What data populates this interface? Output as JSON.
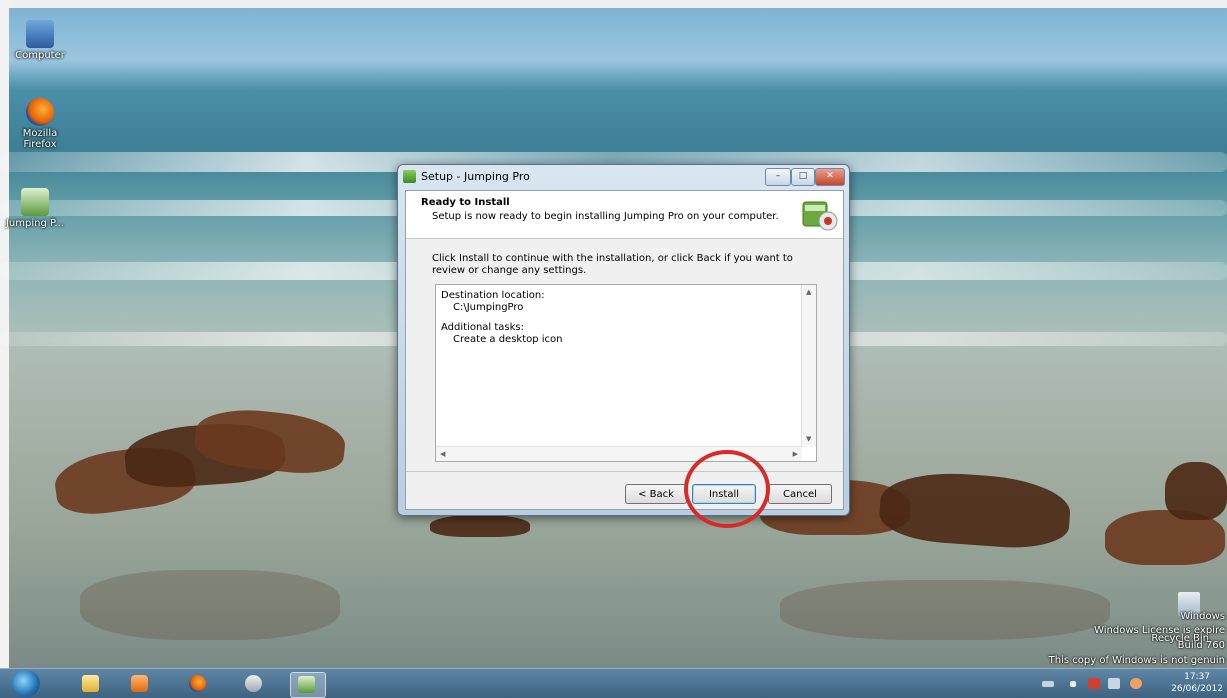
{
  "desktop": {
    "icons": [
      {
        "label": "Computer"
      },
      {
        "label": "Mozilla Firefox"
      },
      {
        "label": "Jumping P..."
      }
    ],
    "recycle_label": "Recycle Bin",
    "watermark": {
      "line1": "Windows",
      "line2": "Windows License is expire",
      "line3": "Build 760",
      "line4": "This copy of Windows is not genuin"
    }
  },
  "dialog": {
    "title": "Setup - Jumping Pro",
    "header_title": "Ready to Install",
    "header_subtitle": "Setup is now ready to begin installing Jumping Pro on your computer.",
    "instruction": "Click Install to continue with the installation, or click Back if you want to review or change any settings.",
    "memo": {
      "dest_label": "Destination location:",
      "dest_value": "C:\\JumpingPro",
      "tasks_label": "Additional tasks:",
      "tasks_value": "Create a desktop icon"
    },
    "buttons": {
      "back": "< Back",
      "install": "Install",
      "cancel": "Cancel"
    },
    "window_buttons": {
      "minimize": "–",
      "maximize": "□",
      "close": "✕"
    }
  },
  "taskbar": {
    "clock_time": "17:37",
    "clock_date": "26/06/2012"
  },
  "colors": {
    "highlight_circle": "#d92a2a",
    "taskbar": "#3d6381",
    "dialog_frame": "#b9cde0"
  }
}
